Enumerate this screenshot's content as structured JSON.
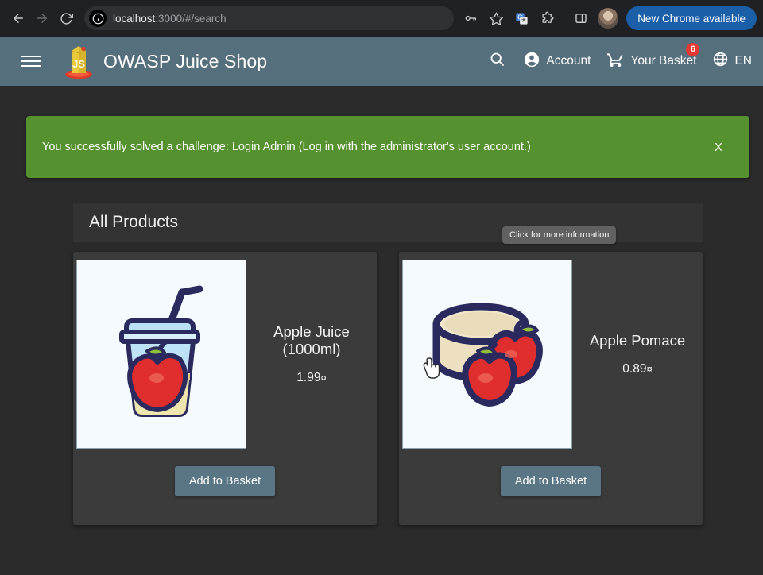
{
  "browser": {
    "back_icon": "back-arrow-icon",
    "forward_icon": "forward-arrow-icon",
    "reload_icon": "reload-icon",
    "site_info_icon": "site-info-icon",
    "url_host": "localhost",
    "url_rest": ":3000/#/search",
    "password_icon": "password-key-icon",
    "bookmark_icon": "bookmark-star-icon",
    "translate_icon": "translate-extension-icon",
    "extensions_icon": "extensions-puzzle-icon",
    "side_panel_icon": "side-panel-icon",
    "avatar_icon": "profile-avatar",
    "update_pill_label": "New Chrome available"
  },
  "app": {
    "menu_icon": "hamburger-menu-icon",
    "logo_icon": "juice-shop-logo",
    "title": "OWASP Juice Shop",
    "search_icon": "search-icon",
    "account_icon": "account-circle-icon",
    "account_label": "Account",
    "basket_icon": "shopping-cart-icon",
    "basket_label": "Your Basket",
    "basket_count": "6",
    "language_icon": "globe-icon",
    "language_label": "EN"
  },
  "snackbar": {
    "message": "You successfully solved a challenge: Login Admin (Log in with the administrator's user account.)",
    "close_label": "X"
  },
  "products_section": {
    "title": "All Products",
    "tooltip": "Click for more information",
    "add_to_basket_label": "Add to Basket"
  },
  "products": [
    {
      "name": "Apple Juice (1000ml)",
      "name_line1": "Apple Juice",
      "name_line2": "(1000ml)",
      "price": "1.99",
      "currency": "¤",
      "image": "apple-juice-cup-image"
    },
    {
      "name": "Apple Pomace",
      "name_line1": "Apple Pomace",
      "name_line2": "",
      "price": "0.89",
      "currency": "¤",
      "image": "apple-pomace-image"
    }
  ],
  "colors": {
    "toolbar": "#566f7d",
    "page_background": "#2b2b2b",
    "card_background": "#3b3b3b",
    "success_green": "#55912f",
    "badge_red": "#e53935",
    "chrome_pill_blue": "#1a5fa8"
  }
}
